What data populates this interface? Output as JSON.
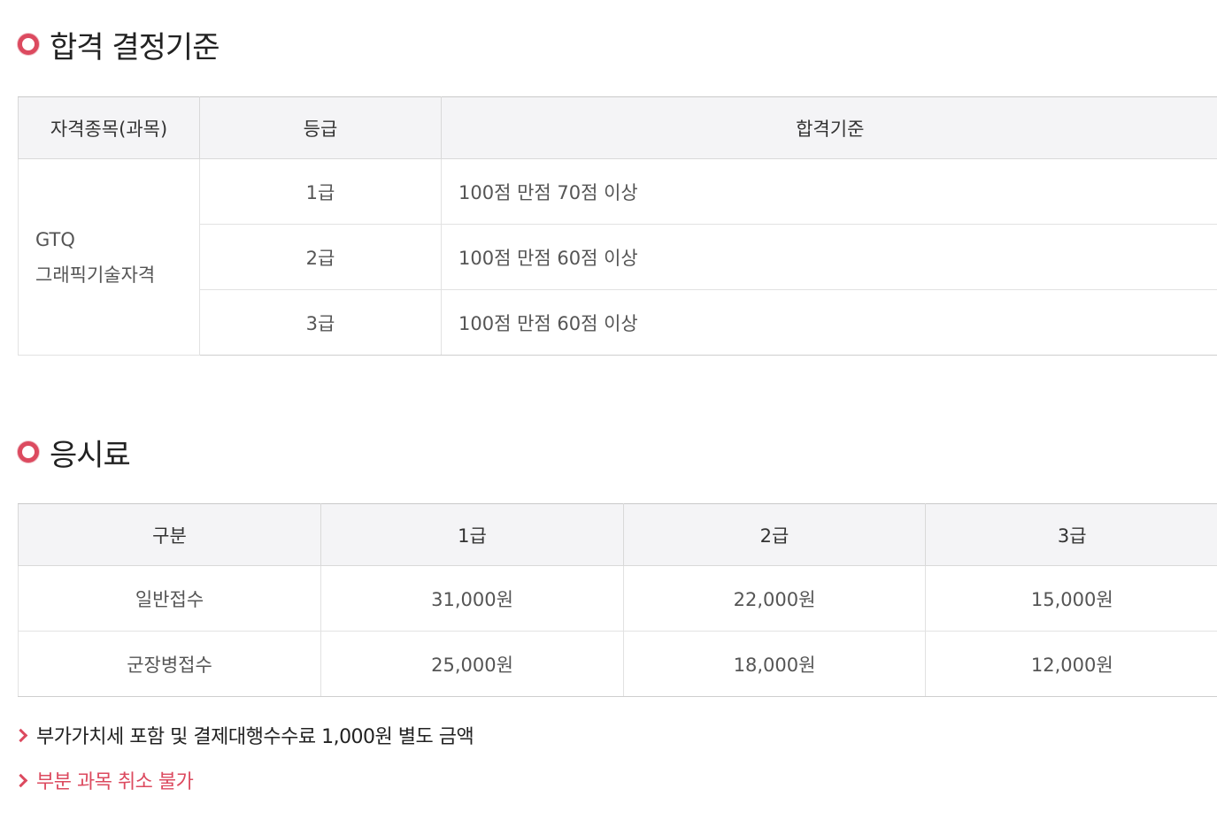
{
  "criteria": {
    "title": "합격 결정기준",
    "headers": [
      "자격종목(과목)",
      "등급",
      "합격기준"
    ],
    "subject_line1": "GTQ",
    "subject_line2": "그래픽기술자격",
    "rows": [
      {
        "grade": "1급",
        "standard": "100점 만점 70점 이상"
      },
      {
        "grade": "2급",
        "standard": "100점 만점 60점 이상"
      },
      {
        "grade": "3급",
        "standard": "100점 만점 60점 이상"
      }
    ]
  },
  "fees": {
    "title": "응시료",
    "headers": [
      "구분",
      "1급",
      "2급",
      "3급"
    ],
    "rows": [
      {
        "type": "일반접수",
        "g1": "31,000원",
        "g2": "22,000원",
        "g3": "15,000원"
      },
      {
        "type": "군장병접수",
        "g1": "25,000원",
        "g2": "18,000원",
        "g3": "12,000원"
      }
    ]
  },
  "notes": [
    "부가가치세 포함 및 결제대행수수료 1,000원 별도 금액",
    "부분 과목 취소 불가"
  ],
  "colors": {
    "accent": "#dc4a5f",
    "header_bg": "#f4f4f6"
  },
  "icons": {
    "section_bullet": "circle-bullet-icon",
    "note_marker": "chevron-right-icon"
  }
}
